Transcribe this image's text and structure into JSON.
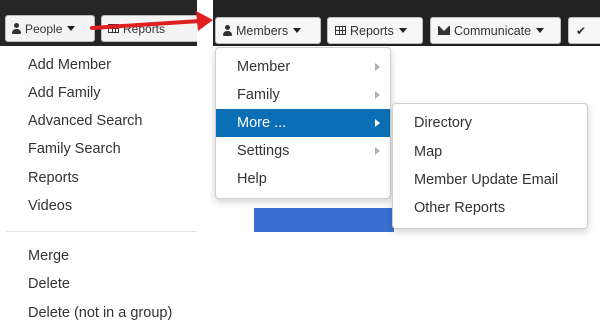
{
  "old_ui": {
    "toolbar": {
      "people_label": "People",
      "reports_label": "Reports"
    },
    "people_menu": {
      "items": [
        "Add Member",
        "Add Family",
        "Advanced Search",
        "Family Search",
        "Reports",
        "Videos"
      ],
      "secondary_items": [
        "Merge",
        "Delete",
        "Delete (not in a group)"
      ]
    }
  },
  "new_ui": {
    "toolbar": {
      "members_label": "Members",
      "reports_label": "Reports",
      "communicate_label": "Communicate",
      "more_icon": "check-icon"
    },
    "members_menu": {
      "items": [
        {
          "label": "Member",
          "has_submenu": true
        },
        {
          "label": "Family",
          "has_submenu": true
        },
        {
          "label": "More ...",
          "has_submenu": true,
          "active": true
        },
        {
          "label": "Settings",
          "has_submenu": true
        },
        {
          "label": "Help",
          "has_submenu": false
        }
      ]
    },
    "more_submenu": {
      "items": [
        "Directory",
        "Map",
        "Member Update Email",
        "Other Reports"
      ]
    }
  },
  "colors": {
    "active_item": "#0a6fb5",
    "annotation_arrow": "#e02020",
    "toolbar_bg": "#222222"
  }
}
